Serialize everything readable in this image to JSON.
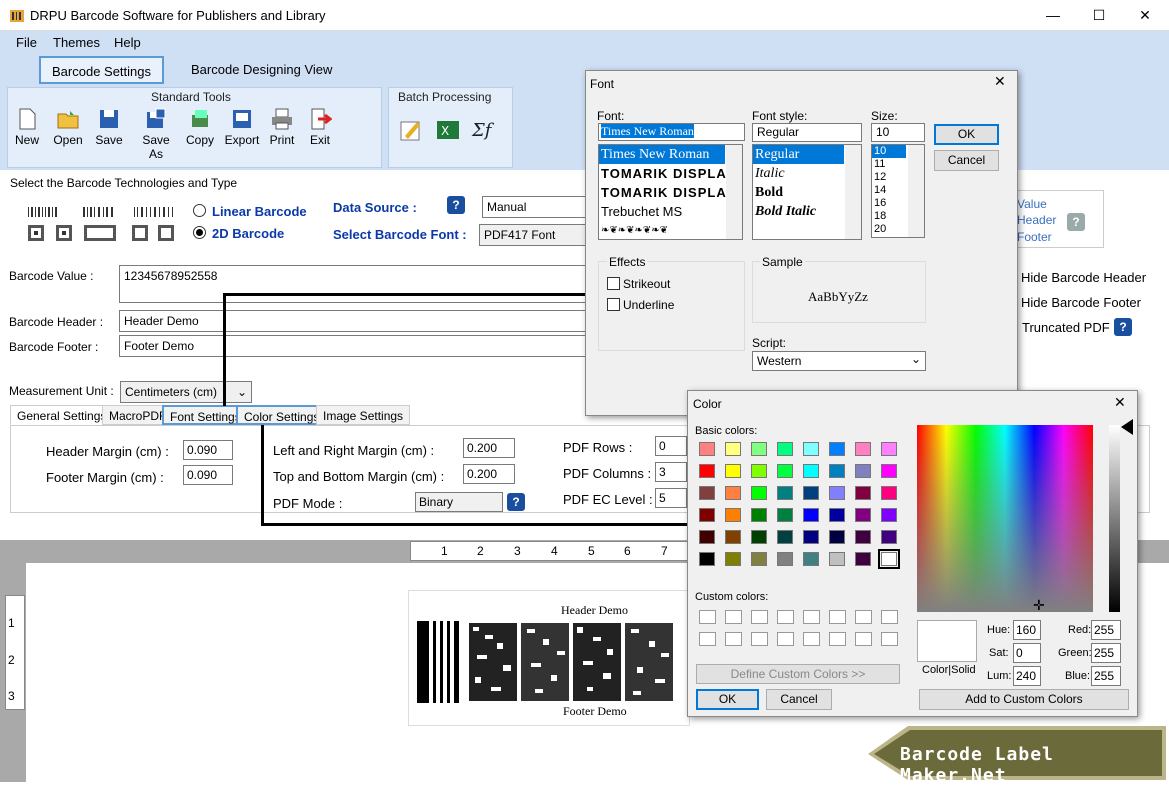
{
  "window": {
    "title": "DRPU Barcode Software for Publishers and Library",
    "minimize": "—",
    "maximize": "☐",
    "close": "✕"
  },
  "menu": {
    "file": "File",
    "themes": "Themes",
    "help": "Help"
  },
  "tabs": {
    "barcode_settings": "Barcode Settings",
    "designing_view": "Barcode Designing View"
  },
  "standard_tools": {
    "title": "Standard Tools",
    "new": "New",
    "open": "Open",
    "save": "Save",
    "save_as": "Save As",
    "copy": "Copy",
    "export": "Export",
    "print": "Print",
    "exit": "Exit"
  },
  "batch": {
    "title": "Batch Processing"
  },
  "tech": {
    "heading": "Select the Barcode Technologies and Type",
    "linear": "Linear Barcode",
    "twod": "2D Barcode",
    "data_source_label": "Data Source :",
    "data_source_value": "Manual",
    "font_label": "Select Barcode Font :",
    "font_value": "PDF417 Font"
  },
  "fields": {
    "value_label": "Barcode Value :",
    "value": "12345678952558",
    "header_label": "Barcode Header :",
    "header": "Header Demo",
    "footer_label": "Barcode Footer :",
    "footer": "Footer Demo",
    "unit_label": "Measurement Unit :",
    "unit": "Centimeters (cm)"
  },
  "right_opts": {
    "value": "Value",
    "header": "Header",
    "footer": "Footer",
    "hide_header": "Hide Barcode Header",
    "hide_footer": "Hide Barcode Footer",
    "truncated": "Truncated PDF"
  },
  "subtabs": {
    "general": "General Settings",
    "macro": "MacroPDF",
    "font": "Font Settings",
    "color": "Color Settings",
    "image": "Image Settings"
  },
  "general": {
    "header_margin_label": "Header Margin (cm) :",
    "header_margin": "0.090",
    "footer_margin_label": "Footer Margin (cm) :",
    "footer_margin": "0.090",
    "lr_margin_label": "Left and Right Margin (cm) :",
    "lr_margin": "0.200",
    "tb_margin_label": "Top and Bottom Margin (cm) :",
    "tb_margin": "0.200",
    "pdf_mode_label": "PDF Mode :",
    "pdf_mode": "Binary",
    "pdf_rows_label": "PDF Rows :",
    "pdf_rows": "0",
    "pdf_cols_label": "PDF Columns :",
    "pdf_cols": "3",
    "pdf_ec_label": "PDF EC Level :",
    "pdf_ec": "5"
  },
  "ruler": {
    "h": [
      "1",
      "2",
      "3",
      "4",
      "5",
      "6",
      "7"
    ],
    "v": [
      "1",
      "2",
      "3"
    ]
  },
  "preview": {
    "header": "Header Demo",
    "footer": "Footer Demo"
  },
  "font_dialog": {
    "title": "Font",
    "font_label": "Font:",
    "font_value": "Times New Roman",
    "fonts": [
      "Times New Roman",
      "TOMARIK DISPLA",
      "TOMARIK DISPLA",
      "Trebuchet MS",
      "❧❦❧❦❧❦❧❦"
    ],
    "style_label": "Font style:",
    "style_value": "Regular",
    "styles": [
      "Regular",
      "Italic",
      "Bold",
      "Bold Italic"
    ],
    "size_label": "Size:",
    "size_value": "10",
    "sizes": [
      "10",
      "11",
      "12",
      "14",
      "16",
      "18",
      "20"
    ],
    "ok": "OK",
    "cancel": "Cancel",
    "effects": "Effects",
    "strikeout": "Strikeout",
    "underline": "Underline",
    "sample": "Sample",
    "sample_text": "AaBbYyZz",
    "script_label": "Script:",
    "script_value": "Western"
  },
  "color_dialog": {
    "title": "Color",
    "basic": "Basic colors:",
    "custom": "Custom colors:",
    "define": "Define Custom Colors >>",
    "ok": "OK",
    "cancel": "Cancel",
    "color_solid": "Color|Solid",
    "hue_label": "Hue:",
    "hue": "160",
    "sat_label": "Sat:",
    "sat": "0",
    "lum_label": "Lum:",
    "lum": "240",
    "red_label": "Red:",
    "red": "255",
    "green_label": "Green:",
    "green": "255",
    "blue_label": "Blue:",
    "blue": "255",
    "add": "Add to Custom Colors",
    "swatches": [
      "#ff8080",
      "#ffff80",
      "#80ff80",
      "#00ff80",
      "#80ffff",
      "#0080ff",
      "#ff80c0",
      "#ff80ff",
      "#ff0000",
      "#ffff00",
      "#80ff00",
      "#00ff40",
      "#00ffff",
      "#0080c0",
      "#8080c0",
      "#ff00ff",
      "#804040",
      "#ff8040",
      "#00ff00",
      "#008080",
      "#004080",
      "#8080ff",
      "#800040",
      "#ff0080",
      "#800000",
      "#ff8000",
      "#008000",
      "#008040",
      "#0000ff",
      "#0000a0",
      "#800080",
      "#8000ff",
      "#400000",
      "#804000",
      "#004000",
      "#004040",
      "#000080",
      "#000040",
      "#400040",
      "#400080",
      "#000000",
      "#808000",
      "#808040",
      "#808080",
      "#408080",
      "#c0c0c0",
      "#400040",
      "#ffffff"
    ]
  },
  "brand": {
    "text": "Barcode Label Maker.Net"
  }
}
